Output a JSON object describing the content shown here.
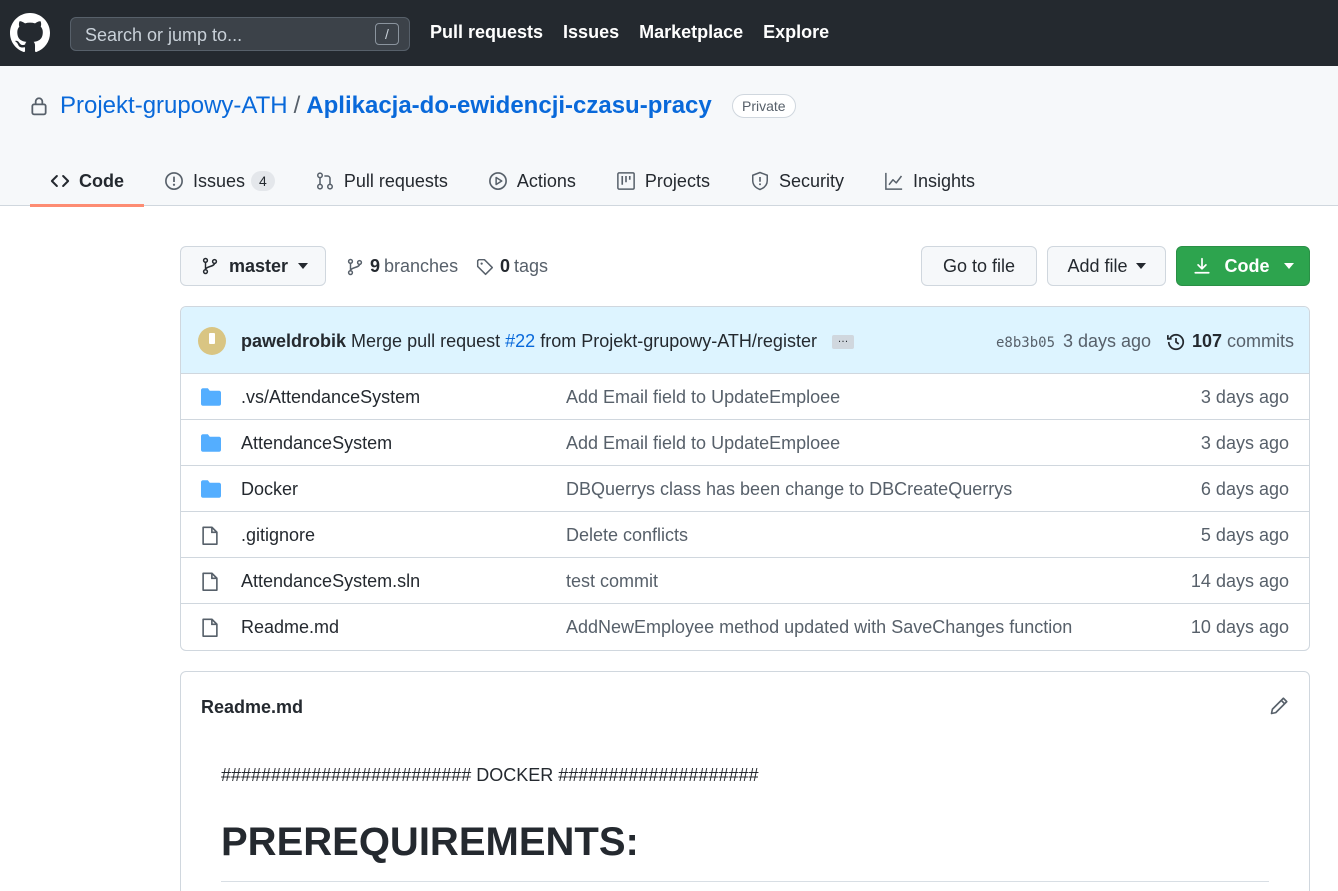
{
  "topbar": {
    "search_placeholder": "Search or jump to...",
    "search_shortcut": "/",
    "nav": [
      "Pull requests",
      "Issues",
      "Marketplace",
      "Explore"
    ]
  },
  "repo": {
    "owner": "Projekt-grupowy-ATH",
    "separator": "/",
    "name": "Aplikacja-do-ewidencji-czasu-pracy",
    "visibility": "Private"
  },
  "tabs": [
    {
      "label": "Code",
      "icon": "code-icon",
      "active": true
    },
    {
      "label": "Issues",
      "icon": "issue-icon",
      "count": "4"
    },
    {
      "label": "Pull requests",
      "icon": "pull-request-icon"
    },
    {
      "label": "Actions",
      "icon": "play-icon"
    },
    {
      "label": "Projects",
      "icon": "project-icon"
    },
    {
      "label": "Security",
      "icon": "shield-icon"
    },
    {
      "label": "Insights",
      "icon": "graph-icon"
    }
  ],
  "branch_bar": {
    "current_branch": "master",
    "branches_count": "9",
    "branches_label": "branches",
    "tags_count": "0",
    "tags_label": "tags",
    "go_to_file": "Go to file",
    "add_file": "Add file",
    "code_button": "Code"
  },
  "latest_commit": {
    "author": "paweldrobik",
    "message_prefix": "Merge pull request",
    "pr_number": "#22",
    "message_suffix": "from Projekt-grupowy-ATH/register",
    "ellipsis": "…",
    "sha": "e8b3b05",
    "age": "3 days ago",
    "commits_count": "107",
    "commits_label": "commits"
  },
  "files": [
    {
      "type": "folder",
      "name": ".vs/AttendanceSystem",
      "message": "Add Email field to UpdateEmploee",
      "age": "3 days ago"
    },
    {
      "type": "folder",
      "name": "AttendanceSystem",
      "message": "Add Email field to UpdateEmploee",
      "age": "3 days ago"
    },
    {
      "type": "folder",
      "name": "Docker",
      "message": "DBQuerrys class has been change to DBCreateQuerrys",
      "age": "6 days ago"
    },
    {
      "type": "file",
      "name": ".gitignore",
      "message": "Delete conflicts",
      "age": "5 days ago"
    },
    {
      "type": "file",
      "name": "AttendanceSystem.sln",
      "message": "test commit",
      "age": "14 days ago"
    },
    {
      "type": "file",
      "name": "Readme.md",
      "message": "AddNewEmployee method updated with SaveChanges function",
      "age": "10 days ago"
    }
  ],
  "readme": {
    "title": "Readme.md",
    "line1": "######################### DOCKER ####################",
    "heading": "PREREQUIREMENTS:"
  },
  "colors": {
    "header_bg": "#24292f",
    "link": "#0969da",
    "code_button": "#2da44e",
    "active_tab_underline": "#fd8c73",
    "commit_bar_bg": "#ddf4ff",
    "folder_icon": "#54aeff"
  }
}
